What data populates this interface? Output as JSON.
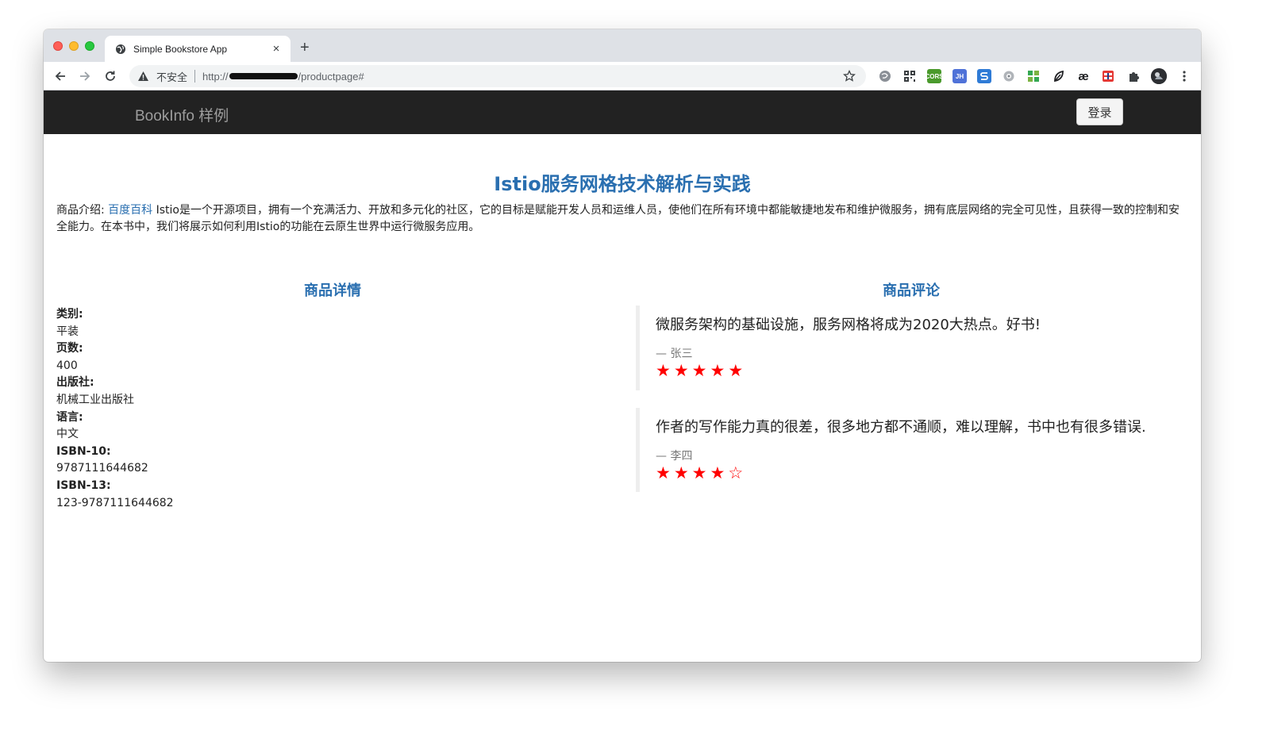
{
  "browser": {
    "tab_title": "Simple Bookstore App",
    "tab_close": "×",
    "new_tab": "+",
    "security_label": "不安全",
    "url_prefix": "http://",
    "url_path": "/productpage#",
    "extension_labels": {
      "cors": "CORS",
      "jh": "JH",
      "ae": "æ"
    }
  },
  "app": {
    "brand": "BookInfo 样例",
    "login_button": "登录"
  },
  "product": {
    "title": "Istio服务网格技术解析与实践",
    "summary_label": "商品介绍: ",
    "summary_link": "百度百科",
    "summary_text": " Istio是一个开源项目，拥有一个充满活力、开放和多元化的社区，它的目标是赋能开发人员和运维人员，使他们在所有环境中都能敏捷地发布和维护微服务，拥有底层网络的完全可见性，且获得一致的控制和安全能力。在本书中，我们将展示如何利用Istio的功能在云原生世界中运行微服务应用。",
    "details_title": "商品详情",
    "reviews_title": "商品评论",
    "details": [
      {
        "label": "类别:",
        "value": "平装"
      },
      {
        "label": "页数:",
        "value": "400"
      },
      {
        "label": "出版社:",
        "value": "机械工业出版社"
      },
      {
        "label": "语言:",
        "value": "中文"
      },
      {
        "label": "ISBN-10:",
        "value": "9787111644682"
      },
      {
        "label": "ISBN-13:",
        "value": "123-9787111644682"
      }
    ]
  },
  "reviews": [
    {
      "text": "微服务架构的基础设施，服务网格将成为2020大热点。好书!",
      "author": "— 张三",
      "rating": 5,
      "max_rating": 5,
      "star_color": "#ff0000"
    },
    {
      "text": "作者的写作能力真的很差，很多地方都不通顺，难以理解，书中也有很多错误.",
      "author": "— 李四",
      "rating": 4,
      "max_rating": 5,
      "star_color": "#ff0000"
    }
  ],
  "colors": {
    "navbar": "#222222",
    "accent": "#2a6fb0",
    "star": "#ff0000"
  }
}
